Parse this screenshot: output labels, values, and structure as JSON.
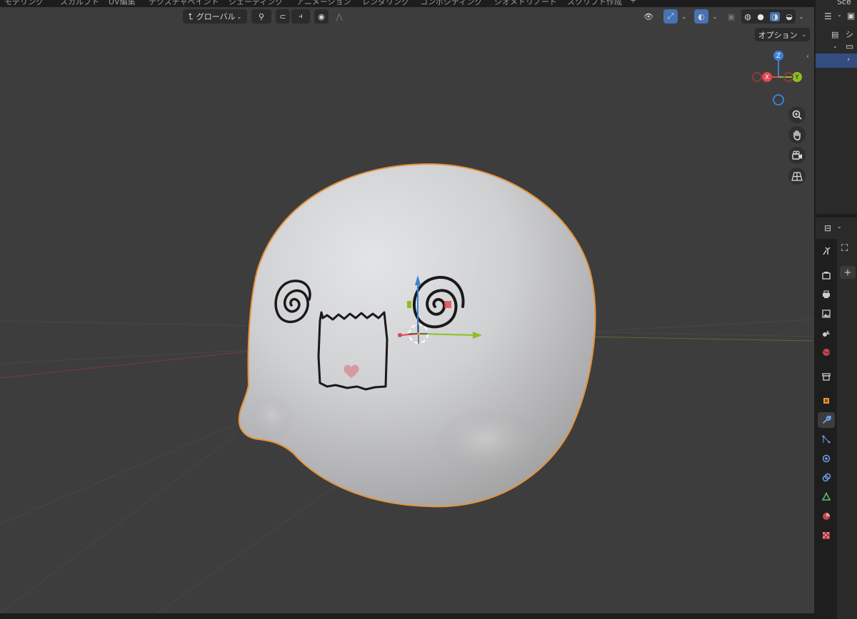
{
  "workspace_tabs": [
    "モデリング",
    "スカルプト",
    "UV編集",
    "テクスチャペイント",
    "シェーディング",
    "アニメーション",
    "レンダリング",
    "コンポジティング",
    "ジオメトリノード",
    "スクリプト作成",
    "+"
  ],
  "header": {
    "transform_orientation": "グローバル",
    "options_label": "オプション"
  },
  "gizmo": {
    "z": "Z",
    "x": "X",
    "y": "Y"
  },
  "outliner": {
    "scene_label": "シー",
    "top_label": "Sce"
  },
  "colors": {
    "viewport_bg": "#3d3d3d",
    "selection_outline": "#e6943a",
    "accent": "#4772b3",
    "axis_x": "#e0464f",
    "axis_y": "#8cbf26",
    "axis_z": "#3e7fd4"
  }
}
